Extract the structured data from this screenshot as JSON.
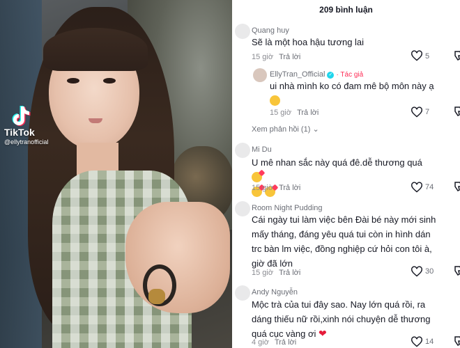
{
  "video": {
    "brand": "TikTok",
    "handle": "@ellytranofficial"
  },
  "comments_panel": {
    "title": "209 bình luận",
    "view_replies": "Xem phản hồi (1)",
    "comments": [
      {
        "name": "Quang huy",
        "text": "Sẽ là một hoa hậu tương lai",
        "time": "15 giờ",
        "reply": "Trả lời",
        "likes": "5"
      },
      {
        "name": "EllyTran_Official",
        "author_tag": "· Tác giả",
        "text": "ui nhà mình ko có đam mê bộ môn này ạ",
        "time": "15 giờ",
        "reply": "Trả lời",
        "likes": "7"
      },
      {
        "name": "Mi Du",
        "text": "U mê nhan sắc này quá đê.dễ thương quá",
        "time": "15 giờ",
        "reply": "Trả lời",
        "likes": "74"
      },
      {
        "name": "Room Night Pudding",
        "text_lines": [
          "Cái ngày tui làm việc bên Đài bé này mới sinh",
          "mấy tháng, đáng yêu quá tui còn in hình dán",
          "trc bàn lm việc, đồng nghiệp cứ hỏi con tôi à,",
          "giờ đã lớn"
        ],
        "time": "15 giờ",
        "reply": "Trả lời",
        "likes": "30"
      },
      {
        "name": "Andy Nguyễn",
        "text_lines": [
          "Mộc trà của tui đây sao. Nay lớn quá rồi, ra",
          "dáng thiếu nữ rồi,xinh nói chuyện dễ thương",
          "quá cục vàng ơi"
        ],
        "time": "4 giờ",
        "reply": "Trả lời",
        "likes": "14"
      }
    ]
  },
  "colors": {
    "accent": "#fe2c55",
    "verified": "#20d5ec",
    "text": "#161823",
    "muted": "#8a8b91"
  }
}
